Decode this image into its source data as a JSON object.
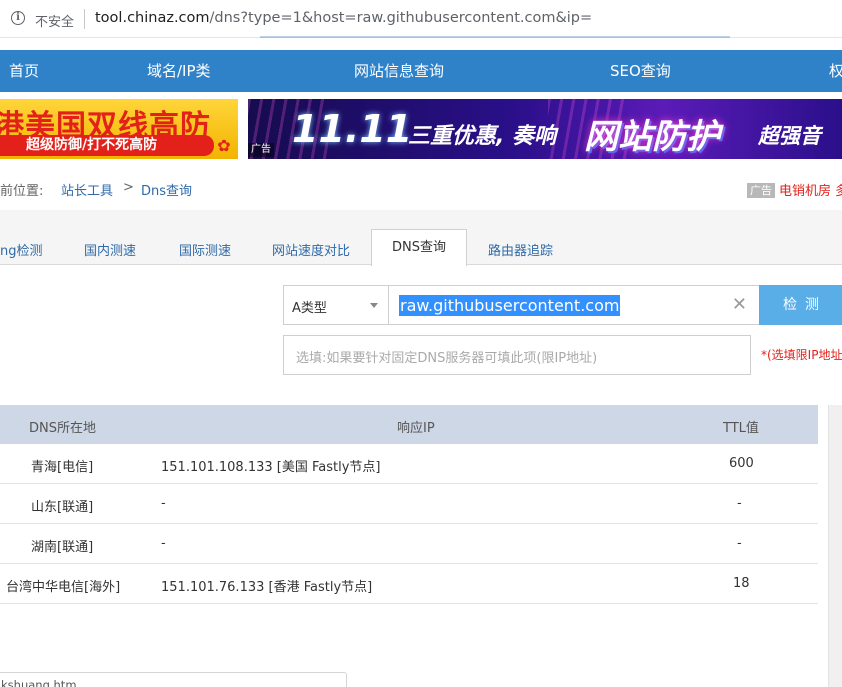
{
  "browser": {
    "security_label": "不安全",
    "url_host": "tool.chinaz.com",
    "url_path": "/dns?type=1&host=raw.githubusercontent.com&ip="
  },
  "nav": {
    "items": [
      "首页",
      "域名/IP类",
      "网站信息查询",
      "SEO查询",
      "权"
    ]
  },
  "banners": {
    "left_title": "港美国双线高防",
    "left_sub": "超级防御/打不死高防",
    "right_date": "11.11",
    "right_mid": "三重优惠, 奏响",
    "right_big": "网站防护",
    "right_tail": "超强音",
    "right_ad_tag": "广告"
  },
  "breadcrumb": {
    "prefix": "前位置:",
    "link1": "站长工具",
    "arrow": ">",
    "current": "Dns查询"
  },
  "side_ad": {
    "tag": "广告",
    "text": "电销机房 多"
  },
  "tabs": {
    "items": [
      "ng检测",
      "国内测速",
      "国际测速",
      "网站速度对比",
      "DNS查询",
      "路由器追踪"
    ]
  },
  "form": {
    "type_value": "A类型",
    "host_value": "raw.githubusercontent.com",
    "detect_label": "检测",
    "dns_placeholder": "选填:如果要针对固定DNS服务器可填此项(限IP地址)",
    "dns_note": "*(选填限IP地址"
  },
  "table": {
    "headers": [
      "DNS所在地",
      "响应IP",
      "TTL值"
    ],
    "rows": [
      [
        "青海[电信]",
        "151.101.108.133 [美国 Fastly节点]",
        "600"
      ],
      [
        "山东[联通]",
        "-",
        "-"
      ],
      [
        "湖南[联通]",
        "-",
        "-"
      ],
      [
        "台湾中华电信[海外]",
        "151.101.76.133 [香港 Fastly节点]",
        "18"
      ]
    ]
  },
  "status_bar": {
    "text": "kshuang.htm"
  }
}
